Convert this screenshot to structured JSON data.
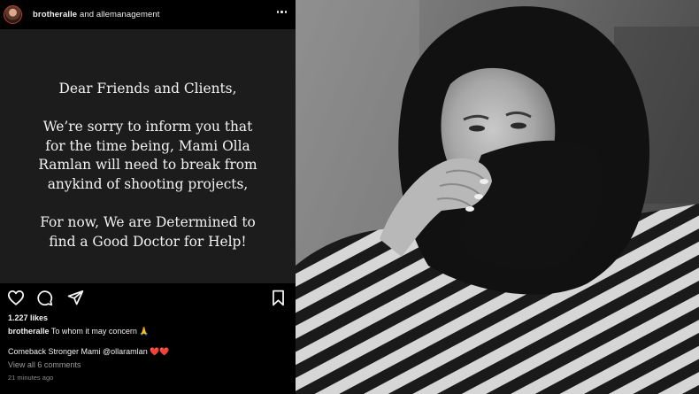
{
  "post": {
    "header": {
      "user1": "brotheralle",
      "and": "and",
      "user2": "allemanagement",
      "avatar_icon": "profile-avatar",
      "more_icon": "more-options-icon"
    },
    "message": {
      "greeting": "Dear Friends and Clients,",
      "line1": "We’re sorry to inform you that",
      "line2": "for the time being, Mami Olla",
      "line3": "Ramlan will need to break from",
      "line4": "anykind of shooting projects,",
      "line5": "For now, We are Determined to",
      "line6": "find a Good Doctor for Help!"
    },
    "actions": {
      "like_icon": "heart-icon",
      "comment_icon": "comment-icon",
      "share_icon": "share-icon",
      "save_icon": "bookmark-icon"
    },
    "likes": "1.227 likes",
    "caption": {
      "user": "brotheralle",
      "text": "To whom it may concern 🙏"
    },
    "comment": "Comeback Stronger Mami @ollaramlan ❤️❤️",
    "view_all": "View all 6 comments",
    "time": "21 minutes ago"
  },
  "colors": {
    "background": "#000000",
    "post_image_bg": "#1c1c1c",
    "text": "#f2f2f2",
    "muted": "#9a9a9a"
  },
  "photo": {
    "description_icon": "portrait-photo"
  }
}
